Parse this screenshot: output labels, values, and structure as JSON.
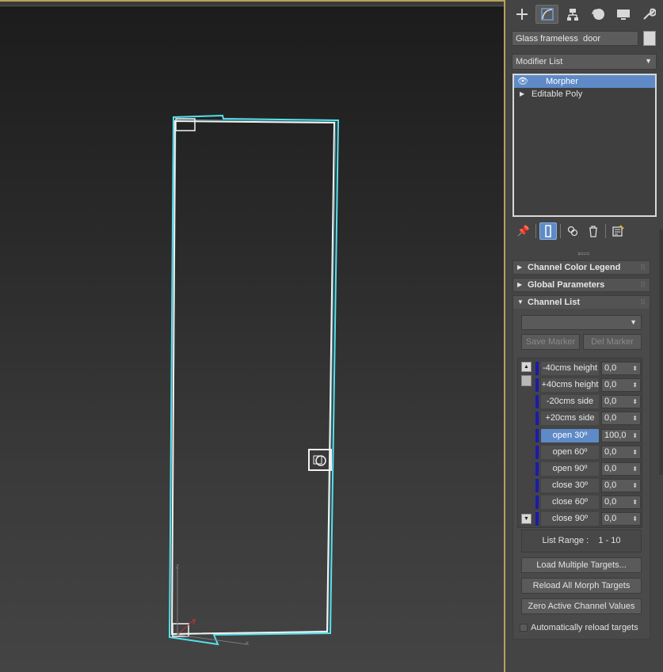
{
  "viewport": {
    "axis_z": "z",
    "axis_x": "x",
    "axis_y": "y"
  },
  "tabs": [
    {
      "id": "create",
      "icon": "plus-icon",
      "active": false
    },
    {
      "id": "modify",
      "icon": "modify-curve-icon",
      "active": true
    },
    {
      "id": "hierarchy",
      "icon": "hierarchy-icon",
      "active": false
    },
    {
      "id": "motion",
      "icon": "motion-icon",
      "active": false
    },
    {
      "id": "display",
      "icon": "display-monitor-icon",
      "active": false
    },
    {
      "id": "utilities",
      "icon": "wrench-icon",
      "active": false
    }
  ],
  "object": {
    "name": "Glass frameless  door",
    "color": "#d7d7d7"
  },
  "modifier_list": {
    "label": "Modifier List"
  },
  "stack": {
    "items": [
      {
        "label": "Morpher",
        "selected": true
      },
      {
        "label": "Editable Poly",
        "selected": false
      }
    ]
  },
  "rollouts": {
    "channel_color_legend": "Channel Color Legend",
    "global_parameters": "Global Parameters",
    "channel_list": "Channel List"
  },
  "channel_list": {
    "marker_selected": "",
    "save_marker": "Save Marker",
    "del_marker": "Del Marker",
    "channels": [
      {
        "name": "-40cms height",
        "value": "0,0",
        "selected": false
      },
      {
        "name": "+40cms height",
        "value": "0,0",
        "selected": false
      },
      {
        "name": "-20cms side",
        "value": "0,0",
        "selected": false
      },
      {
        "name": "+20cms side",
        "value": "0,0",
        "selected": false
      },
      {
        "name": "open 30º",
        "value": "100,0",
        "selected": true
      },
      {
        "name": "open 60º",
        "value": "0,0",
        "selected": false
      },
      {
        "name": "open 90º",
        "value": "0,0",
        "selected": false
      },
      {
        "name": "close 30º",
        "value": "0,0",
        "selected": false
      },
      {
        "name": "close 60º",
        "value": "0,0",
        "selected": false
      },
      {
        "name": "close 90º",
        "value": "0,0",
        "selected": false
      }
    ],
    "list_range_label": "List Range :",
    "list_range_value": "1 - 10",
    "load_multiple": "Load Multiple Targets...",
    "reload_all": "Reload All Morph Targets",
    "zero_active": "Zero Active Channel Values",
    "auto_reload": "Automatically reload targets"
  },
  "colors": {
    "selection_blue": "#5e8ac7",
    "wire_cyan": "#55e0ee",
    "channel_bar": "#1a1ab0",
    "viewport_border": "#b8a25a"
  }
}
